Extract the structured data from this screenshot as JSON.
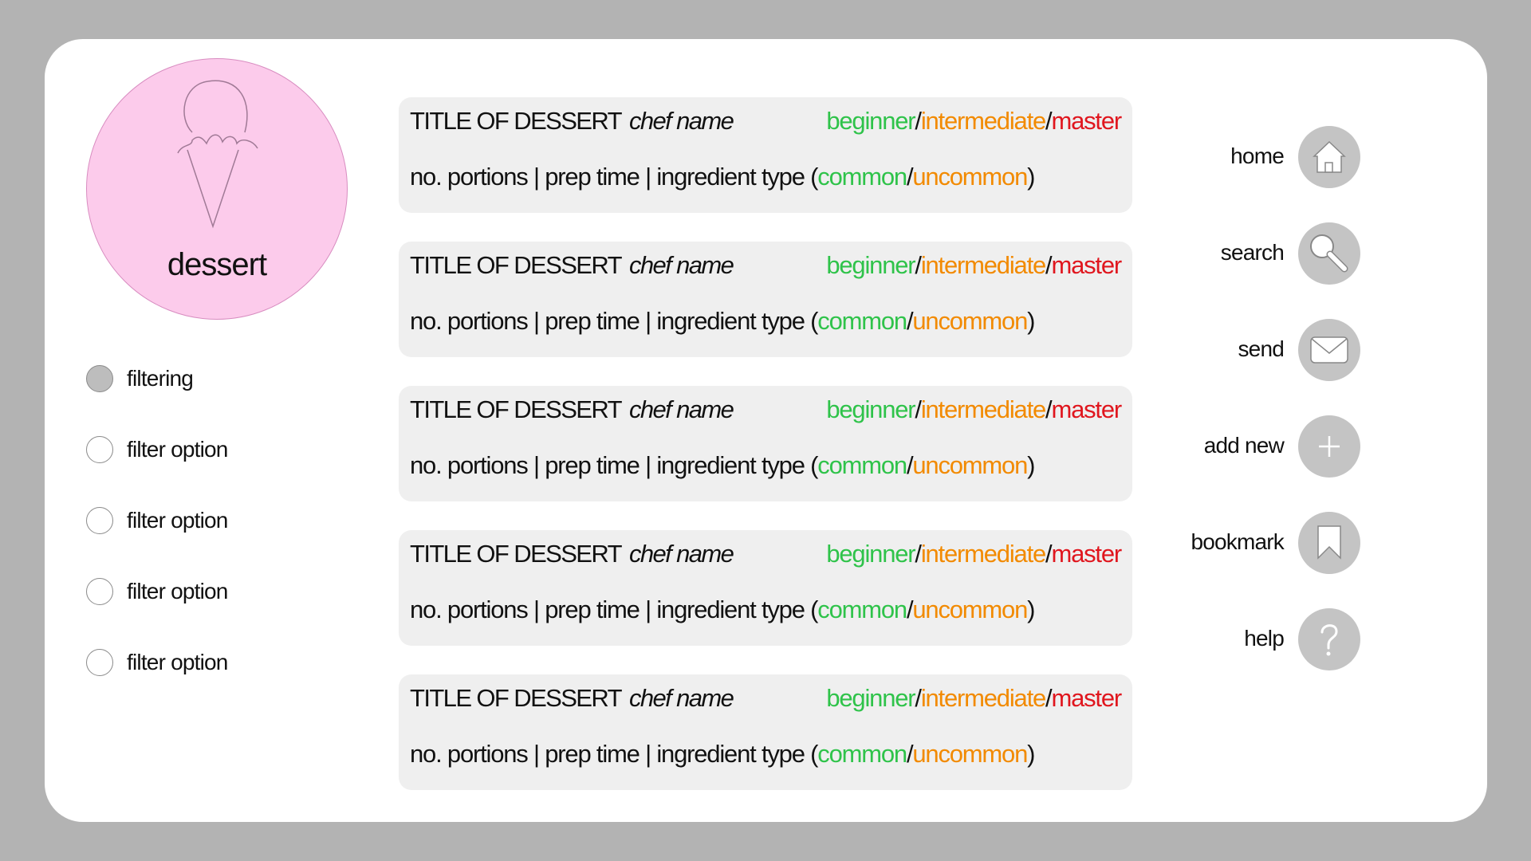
{
  "category": {
    "label": "dessert",
    "icon": "ice-cream-icon",
    "background_color": "#fccbeb"
  },
  "filters": [
    {
      "label": "filtering",
      "checked": true
    },
    {
      "label": "filter option",
      "checked": false
    },
    {
      "label": "filter option",
      "checked": false
    },
    {
      "label": "filter option",
      "checked": false
    },
    {
      "label": "filter option",
      "checked": false
    }
  ],
  "recipes": [
    {
      "title": "TITLE OF DESSERT",
      "chef": "chef name",
      "level_beginner": "beginner",
      "level_intermediate": "intermediate",
      "level_master": "master",
      "meta": "no. portions | prep time | ingredient type (",
      "ingredient_common": "common",
      "ingredient_uncommon": "uncommon",
      "separator": "/",
      "close_paren": ")"
    },
    {
      "title": "TITLE OF DESSERT",
      "chef": "chef name",
      "level_beginner": "beginner",
      "level_intermediate": "intermediate",
      "level_master": "master",
      "meta": "no. portions | prep time | ingredient type (",
      "ingredient_common": "common",
      "ingredient_uncommon": "uncommon",
      "separator": "/",
      "close_paren": ")"
    },
    {
      "title": "TITLE OF DESSERT",
      "chef": "chef name",
      "level_beginner": "beginner",
      "level_intermediate": "intermediate",
      "level_master": "master",
      "meta": "no. portions | prep time | ingredient type (",
      "ingredient_common": "common",
      "ingredient_uncommon": "uncommon",
      "separator": "/",
      "close_paren": ")"
    },
    {
      "title": "TITLE OF DESSERT",
      "chef": "chef name",
      "level_beginner": "beginner",
      "level_intermediate": "intermediate",
      "level_master": "master",
      "meta": "no. portions | prep time | ingredient type (",
      "ingredient_common": "common",
      "ingredient_uncommon": "uncommon",
      "separator": "/",
      "close_paren": ")"
    },
    {
      "title": "TITLE OF DESSERT",
      "chef": "chef name",
      "level_beginner": "beginner",
      "level_intermediate": "intermediate",
      "level_master": "master",
      "meta": "no. portions | prep time | ingredient type (",
      "ingredient_common": "common",
      "ingredient_uncommon": "uncommon",
      "separator": "/",
      "close_paren": ")"
    }
  ],
  "nav": [
    {
      "label": "home",
      "icon": "home-icon"
    },
    {
      "label": "search",
      "icon": "search-icon"
    },
    {
      "label": "send",
      "icon": "envelope-icon"
    },
    {
      "label": "add new",
      "icon": "plus-icon"
    },
    {
      "label": "bookmark",
      "icon": "bookmark-icon"
    },
    {
      "label": "help",
      "icon": "question-icon"
    }
  ],
  "colors": {
    "background": "#b3b3b3",
    "panel": "#ffffff",
    "card": "#efefef",
    "beginner": "#2fc34a",
    "intermediate": "#f28a00",
    "master": "#e0161e",
    "nav_button": "#c4c4c4"
  }
}
